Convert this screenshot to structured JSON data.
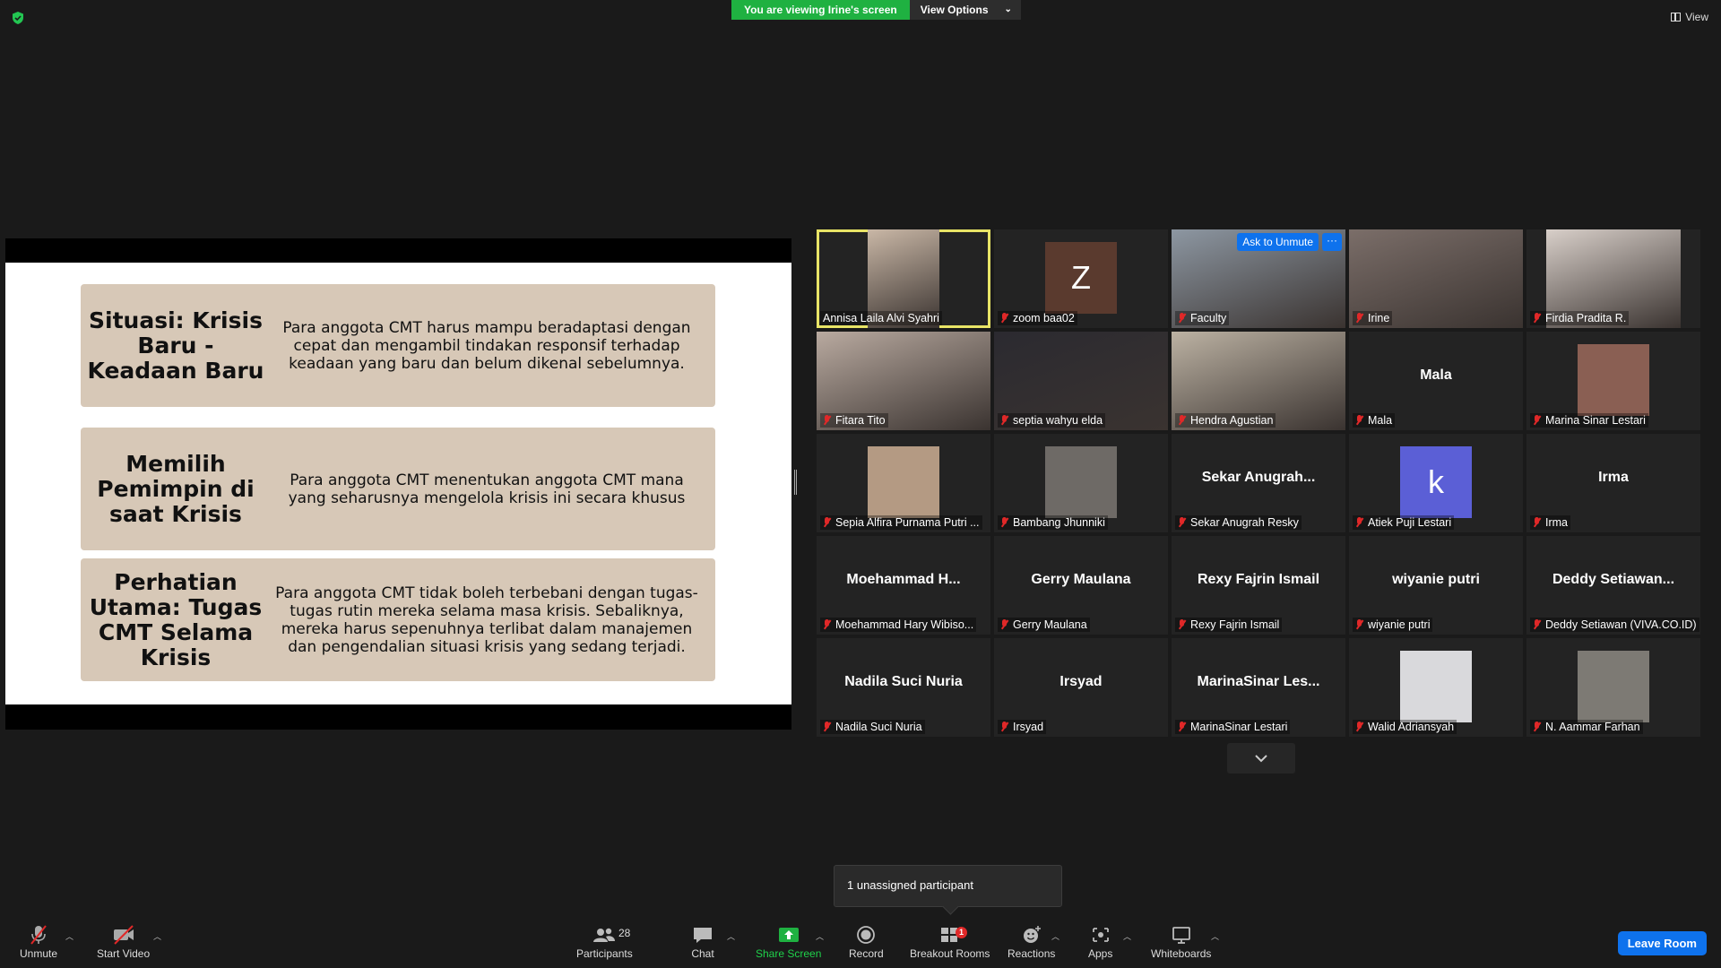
{
  "top_bar": {
    "banner_text": "You are viewing Irine's screen",
    "view_options_label": "View Options",
    "view_label": "View"
  },
  "slide": {
    "cards": [
      {
        "heading": "Situasi: Krisis Baru - Keadaan Baru",
        "body": "Para anggota CMT  harus mampu beradaptasi dengan cepat dan mengambil tindakan responsif terhadap keadaan yang baru dan belum dikenal sebelumnya."
      },
      {
        "heading": "Memilih Pemimpin di saat Krisis",
        "body": "Para anggota CMT menentukan anggota CMT mana yang seharusnya mengelola krisis ini secara khusus"
      },
      {
        "heading": "Perhatian Utama: Tugas CMT Selama Krisis",
        "body": "Para anggota CMT tidak boleh terbebani dengan tugas-tugas rutin mereka selama masa krisis. Sebaliknya, mereka harus sepenuhnya terlibat dalam manajemen dan pengendalian situasi krisis yang sedang terjadi."
      }
    ]
  },
  "gallery": {
    "ask_to_unmute_label": "Ask to Unmute",
    "more_label": "···",
    "tiles": [
      {
        "label": "Annisa Laila Alvi Syahri",
        "center": "",
        "muted": false,
        "kind": "video",
        "bg": "#c9b7a6"
      },
      {
        "label": "zoom baa02",
        "center": "",
        "muted": true,
        "kind": "letter",
        "letter": "Z",
        "bg": "#5a3a2e"
      },
      {
        "label": "Faculty",
        "center": "",
        "muted": true,
        "kind": "video",
        "bg": "#8d97a2"
      },
      {
        "label": "Irine",
        "center": "",
        "muted": true,
        "kind": "video",
        "bg": "#7b6e69"
      },
      {
        "label": "Firdia Pradita R.",
        "center": "",
        "muted": true,
        "kind": "video",
        "bg": "#d8cfc9"
      },
      {
        "label": "Fitara Tito",
        "center": "",
        "muted": true,
        "kind": "video",
        "bg": "#b9aaa0"
      },
      {
        "label": "septia wahyu elda",
        "center": "",
        "muted": true,
        "kind": "video",
        "bg": "#2b2a30"
      },
      {
        "label": "Hendra Agustian",
        "center": "",
        "muted": true,
        "kind": "video",
        "bg": "#bcb2a3"
      },
      {
        "label": "Mala",
        "center": "Mala",
        "muted": true,
        "kind": "name"
      },
      {
        "label": "Marina Sinar Lestari",
        "center": "",
        "muted": true,
        "kind": "photo",
        "bg": "#8a5f53"
      },
      {
        "label": "Sepia Alfira Purnama Putri ...",
        "center": "",
        "muted": true,
        "kind": "photo",
        "bg": "#b49a83"
      },
      {
        "label": "Bambang Jhunniki",
        "center": "",
        "muted": true,
        "kind": "photo",
        "bg": "#6e6a66"
      },
      {
        "label": "Sekar Anugrah Resky",
        "center": "Sekar  Anugrah...",
        "muted": true,
        "kind": "name"
      },
      {
        "label": "Atiek Puji Lestari",
        "center": "",
        "muted": true,
        "kind": "letter",
        "letter": "k",
        "bg": "#5b5fd6"
      },
      {
        "label": "Irma",
        "center": "Irma",
        "muted": true,
        "kind": "name"
      },
      {
        "label": "Moehammad Hary Wibiso...",
        "center": "Moehammad  H...",
        "muted": true,
        "kind": "name"
      },
      {
        "label": "Gerry Maulana",
        "center": "Gerry Maulana",
        "muted": true,
        "kind": "name"
      },
      {
        "label": "Rexy Fajrin Ismail",
        "center": "Rexy Fajrin Ismail",
        "muted": true,
        "kind": "name"
      },
      {
        "label": "wiyanie putri",
        "center": "wiyanie putri",
        "muted": true,
        "kind": "name"
      },
      {
        "label": "Deddy Setiawan (VIVA.CO.ID)",
        "center": "Deddy  Setiawan...",
        "muted": true,
        "kind": "name"
      },
      {
        "label": "Nadila Suci Nuria",
        "center": "Nadila Suci Nuria",
        "muted": true,
        "kind": "name"
      },
      {
        "label": "Irsyad",
        "center": "Irsyad",
        "muted": true,
        "kind": "name"
      },
      {
        "label": "MarinaSinar Lestari",
        "center": "MarinaSinar  Les...",
        "muted": true,
        "kind": "name"
      },
      {
        "label": "Walid Adriansyah",
        "center": "",
        "muted": true,
        "kind": "photo",
        "bg": "#d9d9dc"
      },
      {
        "label": "N. Aammar Farhan",
        "center": "",
        "muted": true,
        "kind": "photo",
        "bg": "#7d7a74"
      }
    ]
  },
  "tooltip": {
    "text": "1 unassigned participant"
  },
  "toolbar": {
    "unmute": "Unmute",
    "start_video": "Start Video",
    "participants": "Participants",
    "participants_count": "28",
    "chat": "Chat",
    "share_screen": "Share Screen",
    "record": "Record",
    "breakout_rooms": "Breakout Rooms",
    "breakout_badge": "1",
    "reactions": "Reactions",
    "apps": "Apps",
    "whiteboards": "Whiteboards",
    "leave": "Leave Room"
  },
  "colors": {
    "accent_green": "#1fb141",
    "accent_blue": "#0e72ed",
    "active_speaker": "#e8e466",
    "muted_red": "#e02828",
    "slide_card": "#d7c8b7"
  }
}
